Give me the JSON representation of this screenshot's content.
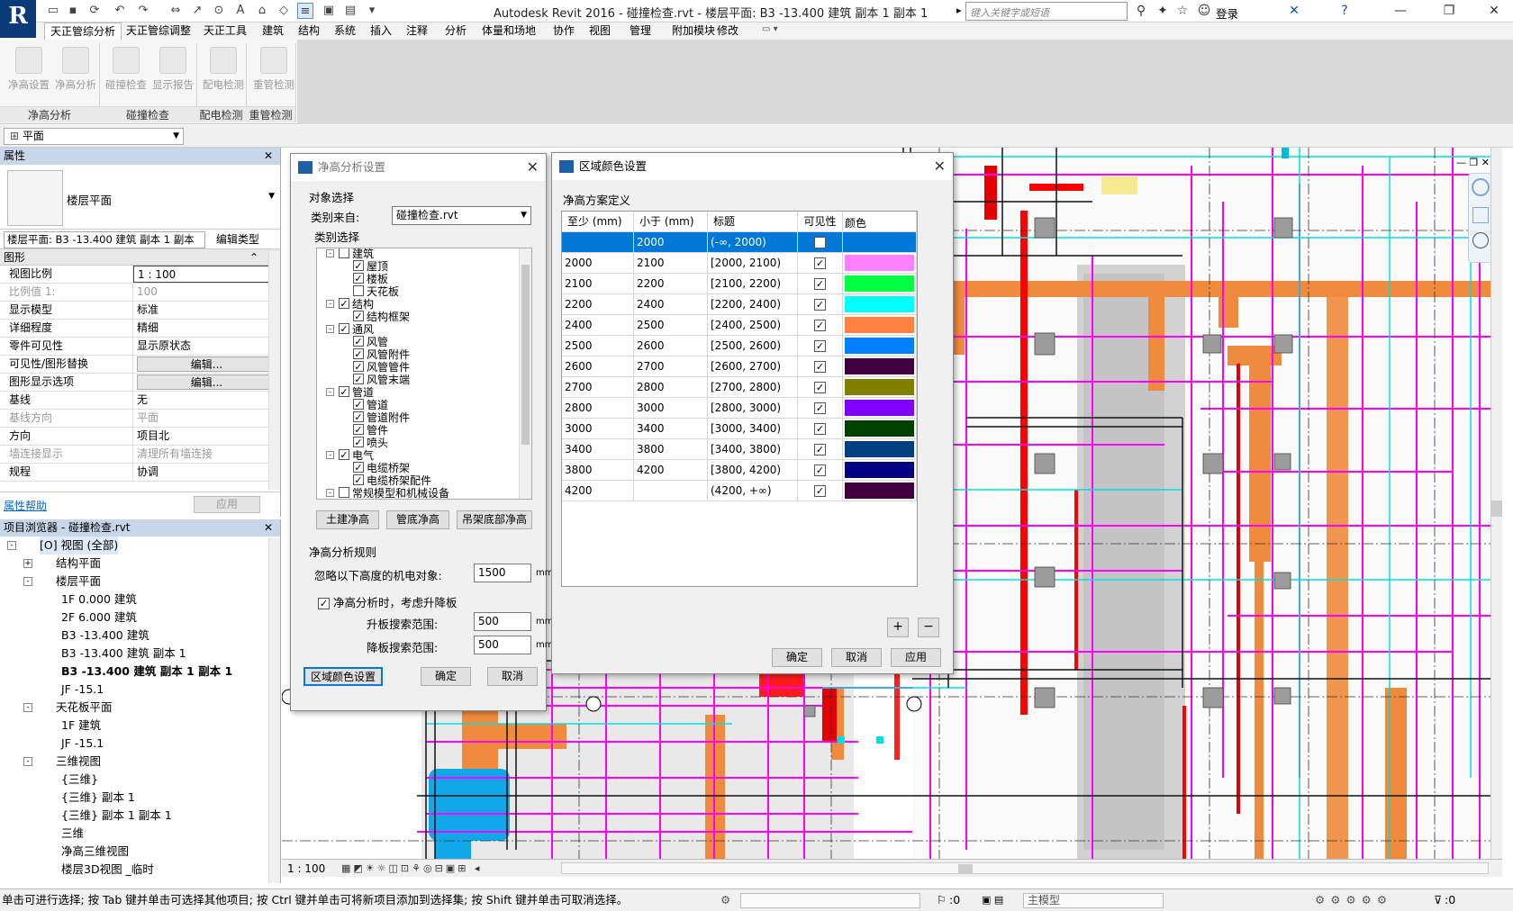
{
  "window": {
    "title": "Autodesk Revit 2016 -    碰撞检查.rvt - 楼层平面: B3 -13.400 建筑 副本 1 副本 1",
    "search_placeholder": "键入关键字或短语",
    "login": "登录"
  },
  "ribbon": {
    "tabs": [
      "天正管综分析",
      "天正管综调整",
      "天正工具",
      "建筑",
      "结构",
      "系统",
      "插入",
      "注释",
      "分析",
      "体量和场地",
      "协作",
      "视图",
      "管理",
      "附加模块",
      "修改"
    ],
    "buttons": [
      "净高设置",
      "净高分析",
      "碰撞检查",
      "显示报告",
      "配电检测",
      "重管检测"
    ],
    "panels": [
      "净高分析",
      "碰撞检查",
      "配电检测",
      "重管检测"
    ]
  },
  "typebar": {
    "selector": "平面"
  },
  "properties": {
    "title": "属性",
    "type_name": "楼层平面",
    "instance": "楼层平面: B3 -13.400 建筑 副本 1 副本",
    "edit_type": "编辑类型",
    "group": "图形",
    "rows": [
      {
        "k": "视图比例",
        "v": "1 : 100"
      },
      {
        "k": "比例值 1:",
        "v": "100",
        "dis": true
      },
      {
        "k": "显示模型",
        "v": "标准"
      },
      {
        "k": "详细程度",
        "v": "精细"
      },
      {
        "k": "零件可见性",
        "v": "显示原状态"
      },
      {
        "k": "可见性/图形替换",
        "v": "编辑...",
        "btn": true
      },
      {
        "k": "图形显示选项",
        "v": "编辑...",
        "btn": true
      },
      {
        "k": "基线",
        "v": "无"
      },
      {
        "k": "基线方向",
        "v": "平面",
        "dis": true
      },
      {
        "k": "方向",
        "v": "项目北"
      },
      {
        "k": "墙连接显示",
        "v": "清理所有墙连接",
        "dis": true
      },
      {
        "k": "规程",
        "v": "协调"
      }
    ],
    "help": "属性帮助",
    "apply": "应用"
  },
  "browser": {
    "title": "项目浏览器 - 碰撞检查.rvt",
    "items": [
      {
        "t": "[O] 视图 (全部)",
        "lv": 0,
        "tg": "-",
        "hl": true
      },
      {
        "t": "结构平面",
        "lv": 1,
        "tg": "+"
      },
      {
        "t": "楼层平面",
        "lv": 1,
        "tg": "-"
      },
      {
        "t": "1F 0.000 建筑",
        "lv": 2
      },
      {
        "t": "2F 6.000 建筑",
        "lv": 2
      },
      {
        "t": "B3 -13.400 建筑",
        "lv": 2
      },
      {
        "t": "B3 -13.400 建筑 副本 1",
        "lv": 2
      },
      {
        "t": "B3 -13.400 建筑 副本 1 副本 1",
        "lv": 2,
        "b": true
      },
      {
        "t": "JF -15.1",
        "lv": 2
      },
      {
        "t": "天花板平面",
        "lv": 1,
        "tg": "-"
      },
      {
        "t": "1F 建筑",
        "lv": 2
      },
      {
        "t": "JF -15.1",
        "lv": 2
      },
      {
        "t": "三维视图",
        "lv": 1,
        "tg": "-"
      },
      {
        "t": "{三维}",
        "lv": 2
      },
      {
        "t": "{三维} 副本 1",
        "lv": 2
      },
      {
        "t": "{三维} 副本 1 副本 1",
        "lv": 2
      },
      {
        "t": "三维",
        "lv": 2
      },
      {
        "t": "净高三维视图",
        "lv": 2
      },
      {
        "t": "楼层3D视图 _临时",
        "lv": 2
      }
    ]
  },
  "clearance_dialog": {
    "title": "净高分析设置",
    "obj_select": "对象选择",
    "source_label": "类别来自:",
    "source_value": "碰撞检查.rvt",
    "cat_select": "类别选择",
    "tree": [
      {
        "t": "建筑",
        "lv": 0,
        "c": false
      },
      {
        "t": "屋顶",
        "lv": 1,
        "c": true
      },
      {
        "t": "楼板",
        "lv": 1,
        "c": true
      },
      {
        "t": "天花板",
        "lv": 1,
        "c": false
      },
      {
        "t": "结构",
        "lv": 0,
        "c": true
      },
      {
        "t": "结构框架",
        "lv": 1,
        "c": true
      },
      {
        "t": "通风",
        "lv": 0,
        "c": true
      },
      {
        "t": "风管",
        "lv": 1,
        "c": true
      },
      {
        "t": "风管附件",
        "lv": 1,
        "c": true
      },
      {
        "t": "风管管件",
        "lv": 1,
        "c": true
      },
      {
        "t": "风管末端",
        "lv": 1,
        "c": true
      },
      {
        "t": "管道",
        "lv": 0,
        "c": true
      },
      {
        "t": "管道",
        "lv": 1,
        "c": true
      },
      {
        "t": "管道附件",
        "lv": 1,
        "c": true
      },
      {
        "t": "管件",
        "lv": 1,
        "c": true
      },
      {
        "t": "喷头",
        "lv": 1,
        "c": true
      },
      {
        "t": "电气",
        "lv": 0,
        "c": true
      },
      {
        "t": "电缆桥架",
        "lv": 1,
        "c": true
      },
      {
        "t": "电缆桥架配件",
        "lv": 1,
        "c": true
      },
      {
        "t": "常规模型和机械设备",
        "lv": 0,
        "c": false
      }
    ],
    "btns": [
      "土建净高",
      "管底净高",
      "吊架底部净高"
    ],
    "rules": "净高分析规则",
    "ignore_label": "忽略以下高度的机电对象:",
    "ignore_value": "1500",
    "unit": "mm",
    "consider_label": "净高分析时，考虑升降板",
    "up_label": "升板搜索范围:",
    "up_value": "500",
    "down_label": "降板搜索范围:",
    "down_value": "500",
    "region_btn": "区域颜色设置",
    "ok": "确定",
    "cancel": "取消"
  },
  "color_dialog": {
    "title": "区域颜色设置",
    "section": "净高方案定义",
    "headers": [
      "至少 (mm)",
      "小于 (mm)",
      "标题",
      "可见性",
      "颜色"
    ],
    "rows": [
      {
        "a": "",
        "b": "2000",
        "t": "(-∞, 2000)",
        "c": "#0078d7"
      },
      {
        "a": "2000",
        "b": "2100",
        "t": "[2000, 2100)",
        "c": "#ff80ff"
      },
      {
        "a": "2100",
        "b": "2200",
        "t": "[2100, 2200)",
        "c": "#00ff40"
      },
      {
        "a": "2200",
        "b": "2400",
        "t": "[2200, 2400)",
        "c": "#00ffff"
      },
      {
        "a": "2400",
        "b": "2500",
        "t": "[2400, 2500)",
        "c": "#ff8040"
      },
      {
        "a": "2500",
        "b": "2600",
        "t": "[2500, 2600)",
        "c": "#0080ff"
      },
      {
        "a": "2600",
        "b": "2700",
        "t": "[2600, 2700)",
        "c": "#400040"
      },
      {
        "a": "2700",
        "b": "2800",
        "t": "[2700, 2800)",
        "c": "#808000"
      },
      {
        "a": "2800",
        "b": "3000",
        "t": "[2800, 3000)",
        "c": "#8000ff"
      },
      {
        "a": "3000",
        "b": "3400",
        "t": "[3000, 3400)",
        "c": "#004000"
      },
      {
        "a": "3400",
        "b": "3800",
        "t": "[3400, 3800)",
        "c": "#004080"
      },
      {
        "a": "3800",
        "b": "4200",
        "t": "[3800, 4200)",
        "c": "#000080"
      },
      {
        "a": "4200",
        "b": "",
        "t": "(4200, +∞)",
        "c": "#400040"
      }
    ],
    "plus": "+",
    "minus": "−",
    "ok": "确定",
    "cancel": "取消",
    "apply": "应用"
  },
  "viewbar": {
    "scale": "1 : 100"
  },
  "status": {
    "text": "单击可进行选择; 按 Tab 键并单击可选择其他项目; 按 Ctrl 键并单击可将新项目添加到选择集; 按 Shift 键并单击可取消选择。",
    "count": ":0",
    "model": "主模型",
    "filter": ":0"
  }
}
